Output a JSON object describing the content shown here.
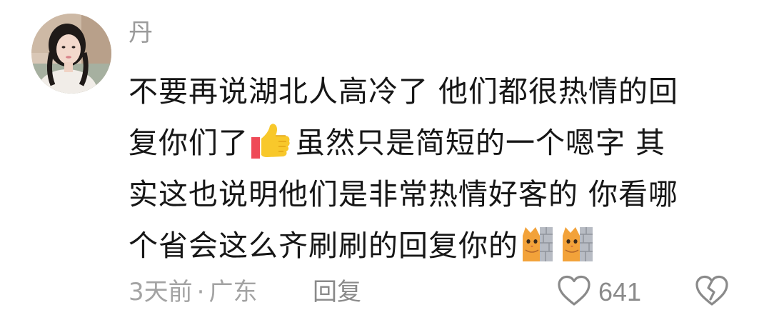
{
  "comment": {
    "username": "丹",
    "text_lines": [
      "不要再说湖北人高冷了  他们都很热情的回",
      "复你们了",
      "虽然只是简短的一个嗯字  其",
      "实这也说明他们是非常热情好客的  你看哪",
      "个省会这么齐刷刷的回复你的"
    ],
    "emojis": {
      "thumbs_up": "thumbs-up-icon",
      "cat_peek": "cat-behind-wall-icon"
    },
    "time": "3天前",
    "separator": "·",
    "location": "广东",
    "reply_label": "回复",
    "like_count": "641"
  },
  "colors": {
    "text": "#161616",
    "meta": "#a3a3a3",
    "icon": "#8a8a8a"
  }
}
